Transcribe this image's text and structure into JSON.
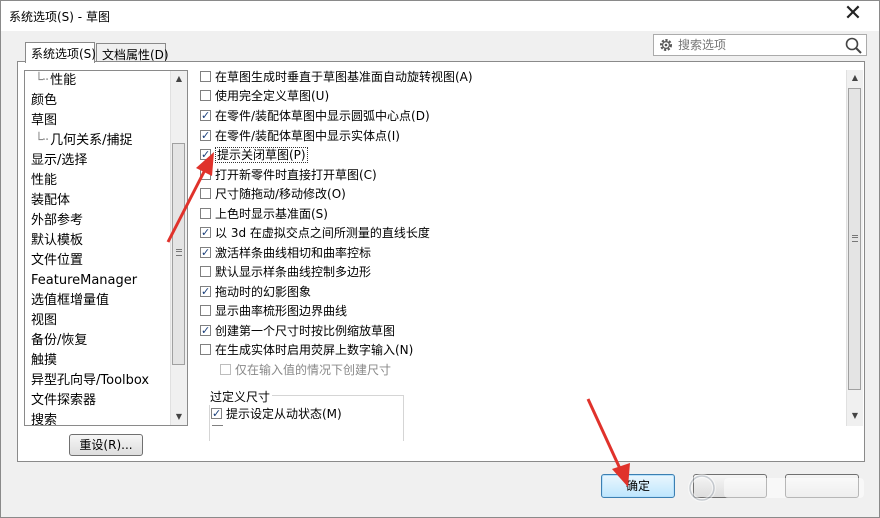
{
  "window": {
    "title": "系统选项(S) - 草图",
    "close_glyph": "✕"
  },
  "tabs": [
    {
      "label": "系统选项(S)",
      "active": true
    },
    {
      "label": "文档属性(D)",
      "active": false
    }
  ],
  "search": {
    "placeholder": "搜索选项"
  },
  "tree": {
    "items": [
      {
        "label": "性能",
        "child": true
      },
      {
        "label": "颜色",
        "child": false
      },
      {
        "label": "草图",
        "child": false
      },
      {
        "label": "几何关系/捕捉",
        "child": true
      },
      {
        "label": "显示/选择",
        "child": false
      },
      {
        "label": "性能",
        "child": false
      },
      {
        "label": "装配体",
        "child": false
      },
      {
        "label": "外部参考",
        "child": false
      },
      {
        "label": "默认模板",
        "child": false
      },
      {
        "label": "文件位置",
        "child": false
      },
      {
        "label": "FeatureManager",
        "child": false
      },
      {
        "label": "选值框增量值",
        "child": false
      },
      {
        "label": "视图",
        "child": false
      },
      {
        "label": "备份/恢复",
        "child": false
      },
      {
        "label": "触摸",
        "child": false
      },
      {
        "label": "异型孔向导/Toolbox",
        "child": false
      },
      {
        "label": "文件探索器",
        "child": false
      },
      {
        "label": "搜索",
        "child": false
      }
    ]
  },
  "options": [
    {
      "label": "在草图生成时垂直于草图基准面自动旋转视图(A)",
      "checked": false
    },
    {
      "label": "使用完全定义草图(U)",
      "checked": false
    },
    {
      "label": "在零件/装配体草图中显示圆弧中心点(D)",
      "checked": true
    },
    {
      "label": "在零件/装配体草图中显示实体点(I)",
      "checked": true
    },
    {
      "label": "提示关闭草图(P)",
      "checked": true,
      "focused": true
    },
    {
      "label": "打开新零件时直接打开草图(C)",
      "checked": false
    },
    {
      "label": "尺寸随拖动/移动修改(O)",
      "checked": false
    },
    {
      "label": "上色时显示基准面(S)",
      "checked": false
    },
    {
      "label": "以 3d 在虚拟交点之间所测量的直线长度",
      "checked": true
    },
    {
      "label": "激活样条曲线相切和曲率控标",
      "checked": true
    },
    {
      "label": "默认显示样条曲线控制多边形",
      "checked": false
    },
    {
      "label": "拖动时的幻影图象",
      "checked": true
    },
    {
      "label": "显示曲率梳形图边界曲线",
      "checked": false
    },
    {
      "label": "创建第一个尺寸时按比例缩放草图",
      "checked": true
    },
    {
      "label": "在生成实体时启用荧屏上数字输入(N)",
      "checked": false
    },
    {
      "label": "仅在输入值的情况下创建尺寸",
      "checked": false,
      "indent": true,
      "disabled": true
    }
  ],
  "group": {
    "label": "过定义尺寸",
    "options": [
      {
        "label": "提示设定从动状态(M)",
        "checked": true
      }
    ]
  },
  "buttons": {
    "reset": "重设(R)...",
    "ok": "确定"
  },
  "colors": {
    "annotation_arrow": "#e0322b",
    "accent": "#3c7fb1"
  }
}
